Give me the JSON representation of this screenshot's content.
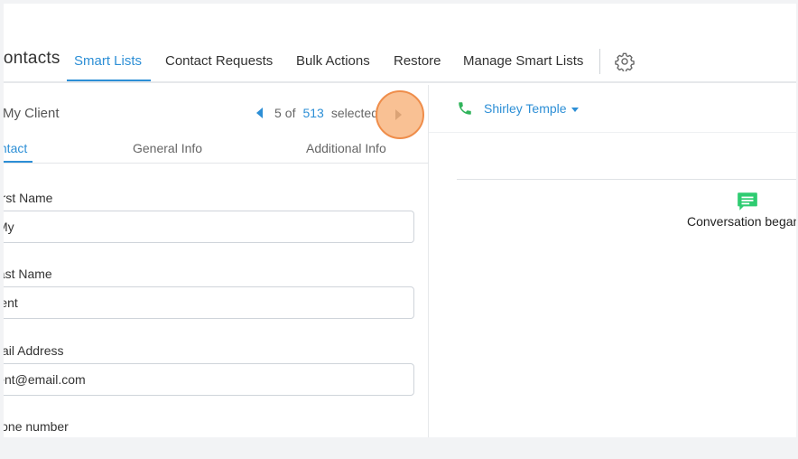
{
  "nav": {
    "title": "Contacts",
    "tabs": [
      {
        "label": "Smart Lists",
        "active": true
      },
      {
        "label": "Contact Requests",
        "active": false
      },
      {
        "label": "Bulk Actions",
        "active": false
      },
      {
        "label": "Restore",
        "active": false
      },
      {
        "label": "Manage Smart Lists",
        "active": false
      }
    ],
    "settings_icon": "gear-icon"
  },
  "left_panel": {
    "client_name": "My Client",
    "pager": {
      "current": "5",
      "of_label": "of",
      "total": "513",
      "suffix": "selected"
    },
    "subtabs": [
      {
        "label": "Contact",
        "active": true
      },
      {
        "label": "General Info",
        "active": false
      },
      {
        "label": "Additional Info",
        "active": false
      }
    ],
    "fields": [
      {
        "label": "First Name",
        "value": "My"
      },
      {
        "label": "Last Name",
        "value": "Client"
      },
      {
        "label": "Email Address",
        "value": "client@email.com"
      },
      {
        "label": "Phone number",
        "value": ""
      }
    ]
  },
  "right_panel": {
    "contact_name": "Shirley Temple",
    "conversation_text": "Conversation began",
    "icons": {
      "phone": "phone-icon",
      "chat": "chat-icon"
    }
  },
  "colors": {
    "accent": "#2d8fd6",
    "phone_green": "#2fb35a",
    "chat_green": "#2ecc71",
    "click_marker": "#f7ac70"
  }
}
